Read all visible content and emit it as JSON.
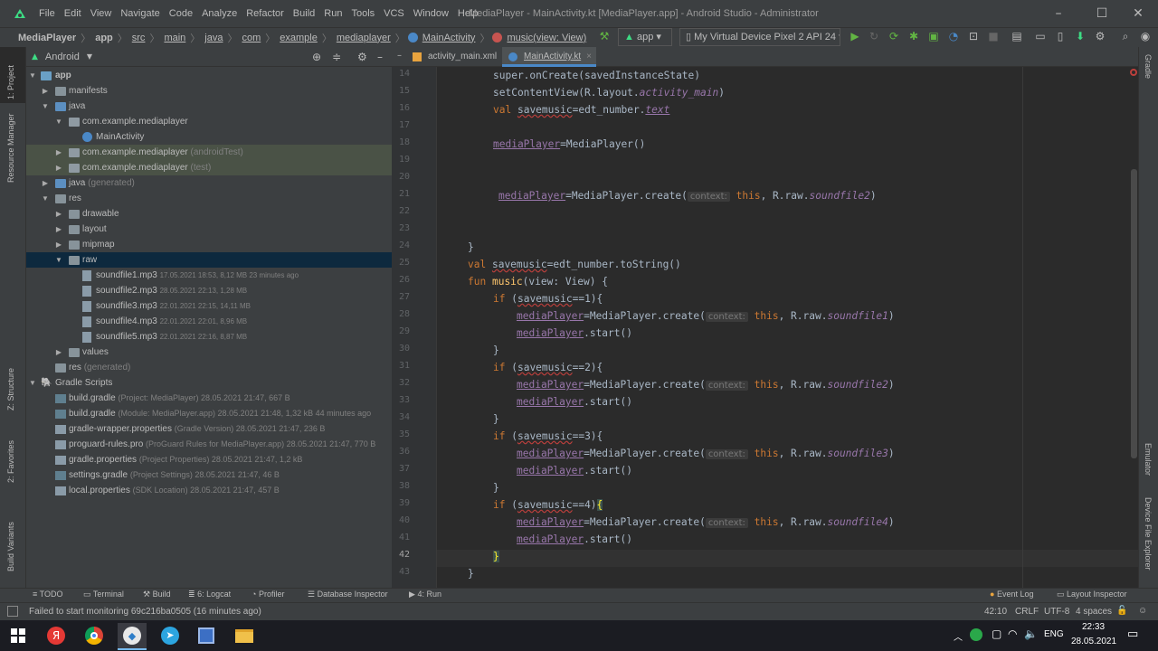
{
  "menubar": {
    "items": [
      "File",
      "Edit",
      "View",
      "Navigate",
      "Code",
      "Analyze",
      "Refactor",
      "Build",
      "Run",
      "Tools",
      "VCS",
      "Window",
      "Help"
    ],
    "title": "MediaPlayer - MainActivity.kt [MediaPlayer.app] - Android Studio - Administrator"
  },
  "breadcrumb": [
    "MediaPlayer",
    "app",
    "src",
    "main",
    "java",
    "com",
    "example",
    "mediaplayer",
    "MainActivity",
    "music(view: View)"
  ],
  "toolbar": {
    "config": "app",
    "device": "My Virtual Device Pixel 2 API 24"
  },
  "left_tabs": [
    "1: Project",
    "Resource Manager",
    "Z: Structure",
    "2: Favorites",
    "Build Variants"
  ],
  "right_tabs": [
    "Gradle",
    "Emulator",
    "Device File Explorer"
  ],
  "project": {
    "view": "Android",
    "tree": [
      {
        "label": "app",
        "meta": ""
      },
      {
        "label": "manifests",
        "meta": ""
      },
      {
        "label": "java",
        "meta": ""
      },
      {
        "label": "com.example.mediaplayer",
        "meta": ""
      },
      {
        "label": "MainActivity",
        "meta": ""
      },
      {
        "label": "com.example.mediaplayer",
        "meta": "(androidTest)"
      },
      {
        "label": "com.example.mediaplayer",
        "meta": "(test)"
      },
      {
        "label": "java",
        "meta": "(generated)"
      },
      {
        "label": "res",
        "meta": ""
      },
      {
        "label": "drawable",
        "meta": ""
      },
      {
        "label": "layout",
        "meta": ""
      },
      {
        "label": "mipmap",
        "meta": ""
      },
      {
        "label": "raw",
        "meta": ""
      },
      {
        "label": "soundfile1.mp3",
        "meta": "17.05.2021 18:53, 8,12 MB 23 minutes ago"
      },
      {
        "label": "soundfile2.mp3",
        "meta": "28.05.2021 22:13, 1,28 MB"
      },
      {
        "label": "soundfile3.mp3",
        "meta": "22.01.2021 22:15, 14,11 MB"
      },
      {
        "label": "soundfile4.mp3",
        "meta": "22.01.2021 22:01, 8,96 MB"
      },
      {
        "label": "soundfile5.mp3",
        "meta": "22.01.2021 22:16, 8,87 MB"
      },
      {
        "label": "values",
        "meta": ""
      },
      {
        "label": "res",
        "meta": "(generated)"
      },
      {
        "label": "Gradle Scripts",
        "meta": ""
      },
      {
        "label": "build.gradle",
        "meta": "(Project: MediaPlayer) 28.05.2021 21:47, 667 B"
      },
      {
        "label": "build.gradle",
        "meta": "(Module: MediaPlayer.app) 28.05.2021 21:48, 1,32 kB 44 minutes ago"
      },
      {
        "label": "gradle-wrapper.properties",
        "meta": "(Gradle Version) 28.05.2021 21:47, 236 B"
      },
      {
        "label": "proguard-rules.pro",
        "meta": "(ProGuard Rules for MediaPlayer.app) 28.05.2021 21:47, 770 B"
      },
      {
        "label": "gradle.properties",
        "meta": "(Project Properties) 28.05.2021 21:47, 1,2 kB"
      },
      {
        "label": "settings.gradle",
        "meta": "(Project Settings) 28.05.2021 21:47, 46 B"
      },
      {
        "label": "local.properties",
        "meta": "(SDK Location) 28.05.2021 21:47, 457 B"
      }
    ]
  },
  "editor": {
    "tabs": [
      "activity_main.xml",
      "MainActivity.kt"
    ],
    "line_numbers": [
      "14",
      "15",
      "16",
      "17",
      "18",
      "19",
      "20",
      "21",
      "22",
      "23",
      "24",
      "25",
      "26",
      "27",
      "28",
      "29",
      "30",
      "31",
      "32",
      "33",
      "34",
      "35",
      "36",
      "37",
      "38",
      "39",
      "40",
      "41",
      "42",
      "43"
    ],
    "hint_context": "context:",
    "tokens": {
      "super_oncreate": "super.onCreate(savedInstanceState)",
      "setcontentview": "setContentView(R.layout.",
      "activity_main": "activity_main",
      "val": "val",
      "savemusic": "savemusic",
      "eq_edt_number": "=edt_number.",
      "text": "text",
      "mediaPlayer": "mediaPlayer",
      "eq_mediaplayer_ctor": "=MediaPlayer()",
      "eq_create": "=MediaPlayer.create(",
      "this": "this",
      "r_raw": ", R.raw.",
      "close_paren": ")",
      "soundfile2": "soundfile2",
      "brace_close": "}",
      "to_string": "=edt_number.toString()",
      "fun": "fun",
      "music": "music",
      "view_param": "(view",
      "view_type": ": View) {",
      "if": "if",
      "open_paren": " (",
      "eq1": "==1){",
      "eq2": "==2){",
      "eq3": "==3){",
      "eq4": "==4)",
      "brace_open": "{",
      "soundfile1": "soundfile1",
      "soundfile3": "soundfile3",
      "soundfile4": "soundfile4",
      "start": ".start()"
    }
  },
  "bottom_tabs": [
    "TODO",
    "Terminal",
    "Build",
    "6: Logcat",
    "Profiler",
    "Database Inspector",
    "4: Run",
    "Event Log",
    "Layout Inspector"
  ],
  "status": {
    "message": "Failed to start monitoring 69c216ba0505 (16 minutes ago)",
    "position": "42:10",
    "line_sep": "CRLF",
    "encoding": "UTF-8",
    "indent": "4 spaces"
  },
  "taskbar": {
    "lang": "ENG",
    "time": "22:33",
    "date": "28.05.2021"
  },
  "colors": {
    "keyword": "#cc7832",
    "function": "#ffc66d",
    "property": "#9876aa",
    "text": "#a9b7c6",
    "selection": "#0d293e",
    "accent": "#4a88c7"
  }
}
